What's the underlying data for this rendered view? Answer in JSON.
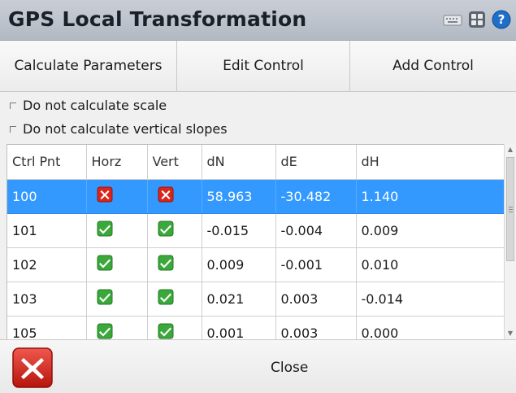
{
  "window": {
    "title": "GPS Local Transformation",
    "icons": [
      "keyboard-icon",
      "grid-icon",
      "help-icon"
    ]
  },
  "actions": [
    {
      "label": "Calculate Parameters"
    },
    {
      "label": "Edit Control"
    },
    {
      "label": "Add Control"
    }
  ],
  "options": [
    {
      "label": "Do not calculate scale",
      "checked": false
    },
    {
      "label": "Do not calculate vertical slopes",
      "checked": false
    }
  ],
  "table": {
    "columns": [
      "Ctrl Pnt",
      "Horz",
      "Vert",
      "dN",
      "dE",
      "dH"
    ],
    "rows": [
      {
        "pnt": "100",
        "horz": "fail",
        "vert": "fail",
        "dN": "58.963",
        "dE": "-30.482",
        "dH": "1.140",
        "selected": true
      },
      {
        "pnt": "101",
        "horz": "ok",
        "vert": "ok",
        "dN": "-0.015",
        "dE": "-0.004",
        "dH": "0.009",
        "selected": false
      },
      {
        "pnt": "102",
        "horz": "ok",
        "vert": "ok",
        "dN": "0.009",
        "dE": "-0.001",
        "dH": "0.010",
        "selected": false
      },
      {
        "pnt": "103",
        "horz": "ok",
        "vert": "ok",
        "dN": "0.021",
        "dE": "0.003",
        "dH": "-0.014",
        "selected": false
      },
      {
        "pnt": "105",
        "horz": "ok",
        "vert": "ok",
        "dN": "0.001",
        "dE": "0.003",
        "dH": "0.000",
        "selected": false
      }
    ]
  },
  "footer": {
    "close_label": "Close",
    "close_icon": "close-x-icon"
  },
  "colors": {
    "selection": "#3399ff",
    "ok": "#2e9b2e",
    "fail": "#d9261c"
  }
}
